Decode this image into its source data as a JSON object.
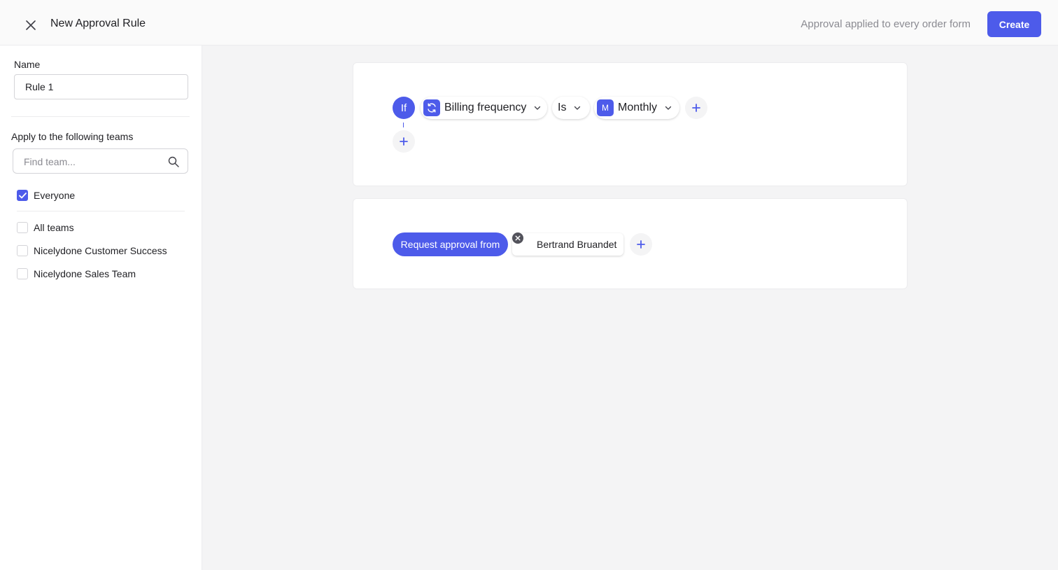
{
  "header": {
    "title": "New Approval Rule",
    "note": "Approval applied to every order form",
    "create_label": "Create"
  },
  "sidebar": {
    "name_label": "Name",
    "name_value": "Rule 1",
    "teams_label": "Apply to the following teams",
    "search_placeholder": "Find team...",
    "options": [
      {
        "label": "Everyone",
        "checked": true
      },
      {
        "label": "All teams",
        "checked": false
      },
      {
        "label": "Nicelydone Customer Success",
        "checked": false
      },
      {
        "label": "Nicelydone Sales Team",
        "checked": false
      }
    ]
  },
  "condition": {
    "if_label": "If",
    "field_label": "Billing frequency",
    "field_icon": "refresh-icon",
    "operator_label": "Is",
    "value_tag": "M",
    "value_label": "Monthly"
  },
  "approval": {
    "request_label": "Request approval from",
    "approver_name": "Bertrand Bruandet"
  },
  "colors": {
    "accent": "#4d5bea",
    "muted_text": "#8b8b92",
    "background": "#f4f4f5"
  }
}
